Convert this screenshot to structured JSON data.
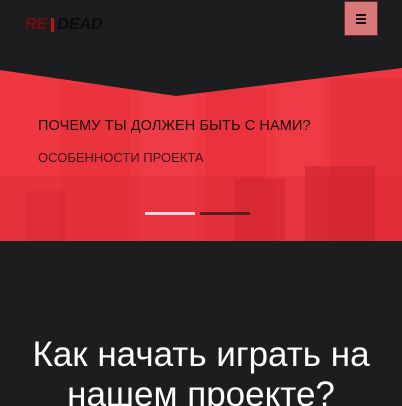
{
  "header": {
    "logo": {
      "part1": "RE",
      "part2": "DEAD"
    },
    "menu_icon": "hamburger-icon"
  },
  "hero": {
    "title": "ПОЧЕМУ ТЫ ДОЛЖЕН БЫТЬ С НАМИ?",
    "subtitle": "ОСОБЕННОСТИ ПРОЕКТА",
    "slides": 2,
    "active_slide": 1
  },
  "section": {
    "heading": "Как начать играть на нашем проекте?"
  },
  "colors": {
    "background": "#1c1d1f",
    "accent": "#ed3340",
    "menu_button": "#d9787a"
  }
}
